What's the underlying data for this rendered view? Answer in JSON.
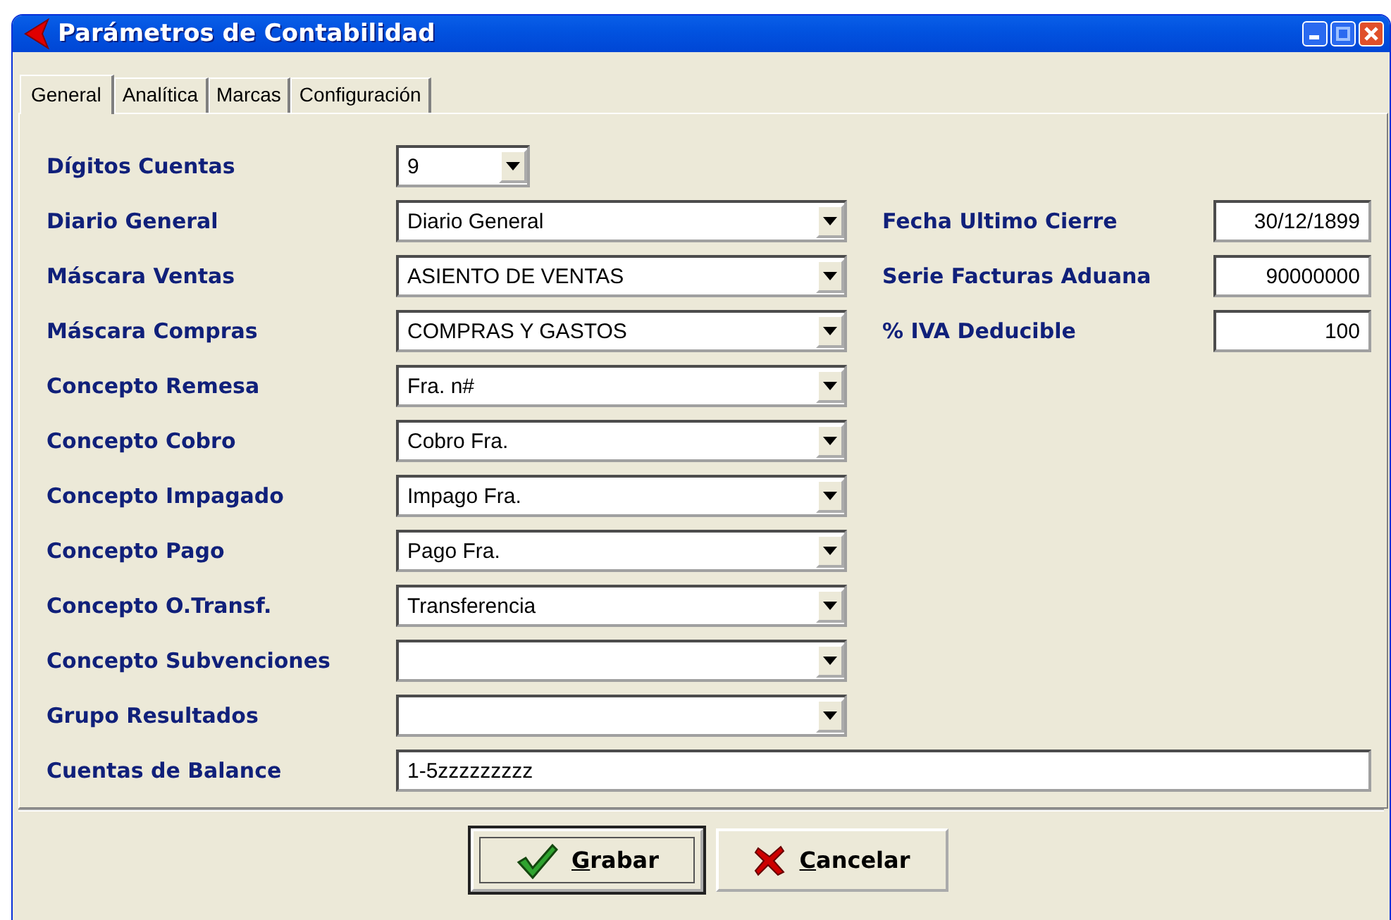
{
  "window": {
    "title": "Parámetros de Contabilidad"
  },
  "tabs": [
    {
      "label": "General",
      "selected": true
    },
    {
      "label": "Analítica",
      "selected": false
    },
    {
      "label": "Marcas",
      "selected": false
    },
    {
      "label": "Configuración",
      "selected": false
    }
  ],
  "fields": [
    {
      "label": "Dígitos Cuentas",
      "kind": "narrow-combo",
      "value": "9"
    },
    {
      "label": "Diario General",
      "kind": "combo",
      "value": "Diario General"
    },
    {
      "label": "Máscara Ventas",
      "kind": "combo",
      "value": "ASIENTO DE VENTAS"
    },
    {
      "label": "Máscara Compras",
      "kind": "combo",
      "value": "COMPRAS Y GASTOS"
    },
    {
      "label": "Concepto Remesa",
      "kind": "combo",
      "value": "Fra. n#"
    },
    {
      "label": "Concepto Cobro",
      "kind": "combo",
      "value": "Cobro Fra."
    },
    {
      "label": "Concepto Impagado",
      "kind": "combo",
      "value": "Impago Fra."
    },
    {
      "label": "Concepto Pago",
      "kind": "combo",
      "value": "Pago Fra."
    },
    {
      "label": "Concepto O.Transf.",
      "kind": "combo",
      "value": "Transferencia"
    },
    {
      "label": "Concepto Subvenciones",
      "kind": "combo"
    },
    {
      "label": "Grupo Resultados",
      "kind": "combo"
    },
    {
      "label": "Cuentas de Balance",
      "kind": "wide-text",
      "value": "1-5zzzzzzzzz"
    }
  ],
  "right_fields": [
    {
      "label": "Fecha Ultimo Cierre",
      "value": "30/12/1899"
    },
    {
      "label": "Serie Facturas Aduana",
      "value": "90000000"
    },
    {
      "label": "% IVA Deducible",
      "value": "100"
    }
  ],
  "buttons": [
    {
      "label": "Grabar",
      "kind": "save",
      "focused": true
    },
    {
      "label": "Cancelar",
      "kind": "cancel",
      "focused": false
    }
  ]
}
